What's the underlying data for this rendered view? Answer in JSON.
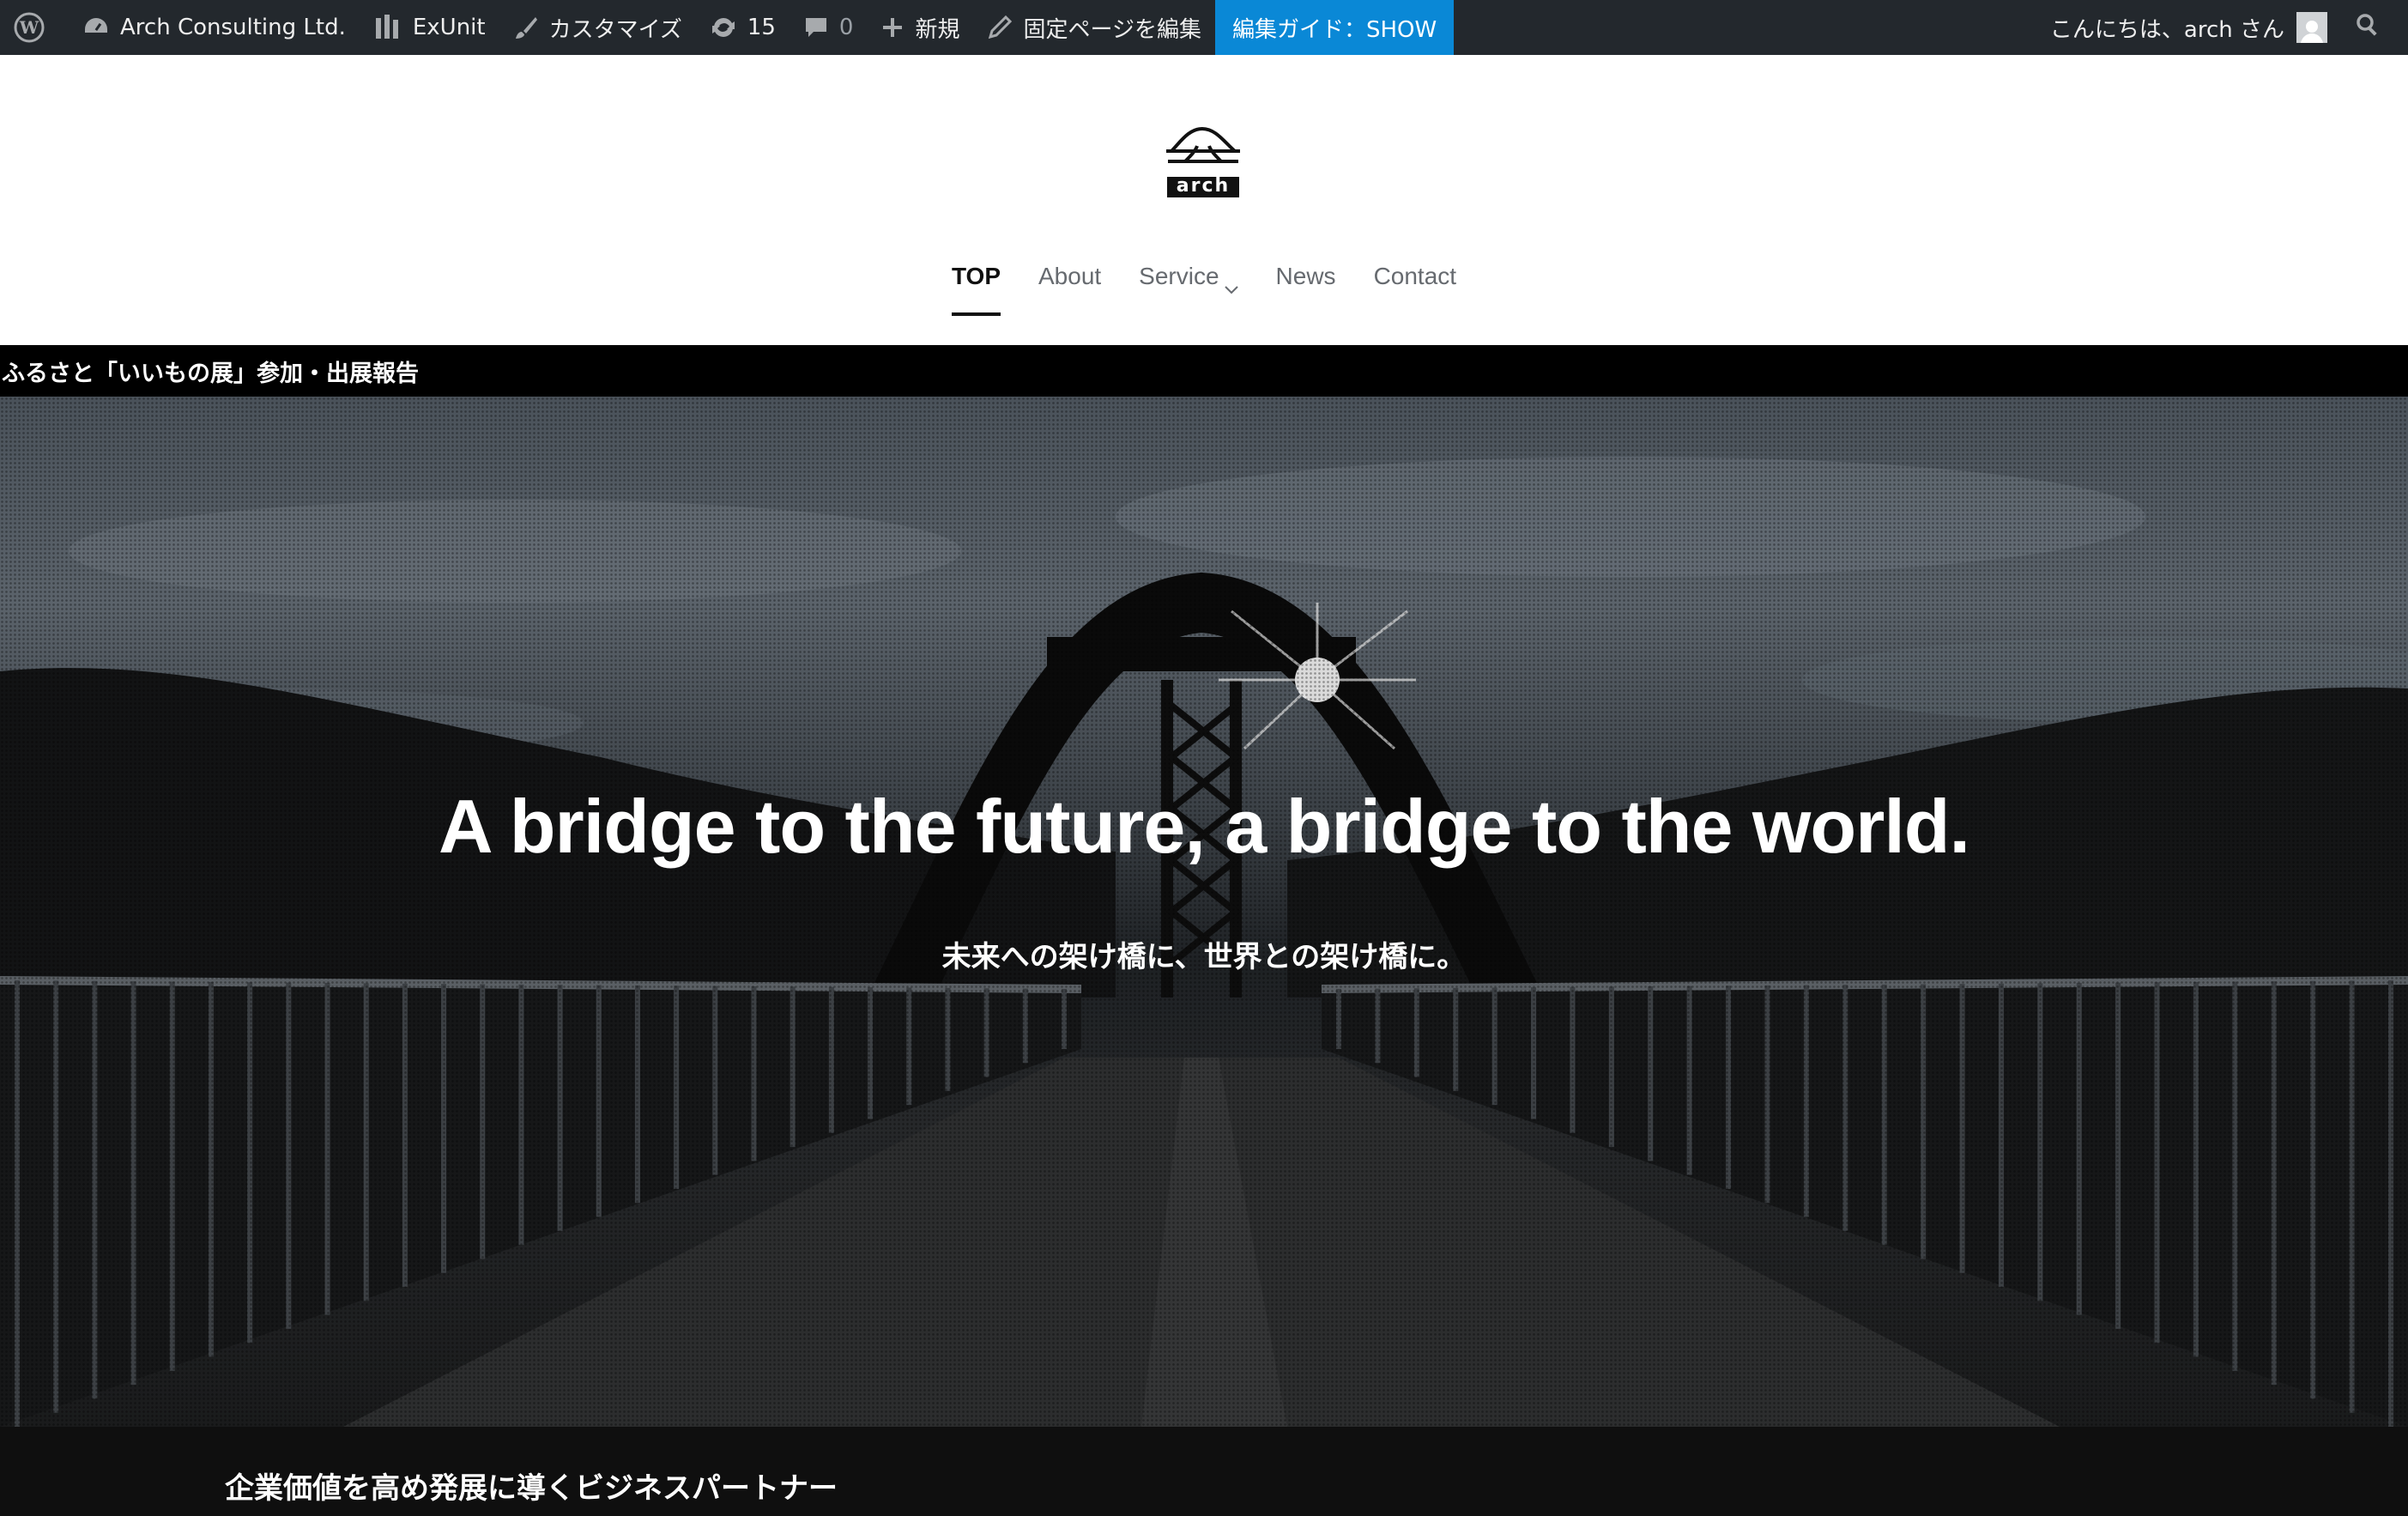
{
  "adminbar": {
    "site_name": "Arch Consulting Ltd.",
    "exunit": "ExUnit",
    "customize": "カスタマイズ",
    "updates_count": "15",
    "comments_count": "0",
    "new": "新規",
    "edit_page": "固定ページを編集",
    "guide": "編集ガイド：SHOW",
    "greeting": "こんにちは、arch さん"
  },
  "logo": {
    "text": "arch"
  },
  "nav": {
    "items": [
      "TOP",
      "About",
      "Service",
      "News",
      "Contact"
    ]
  },
  "ticker": {
    "text": "ふるさと「いいもの展」参加・出展報告"
  },
  "hero": {
    "title": "A bridge to the future, a bridge to the world.",
    "subtitle": "未来への架け橋に、世界との架け橋に。"
  },
  "section": {
    "title": "企業価値を高め発展に導くビジネスパートナー"
  },
  "colors": {
    "adminbar_bg": "#23282d",
    "guide_bg": "#0a88d6",
    "nav_active": "#111111",
    "ticker_bg": "#000000"
  }
}
